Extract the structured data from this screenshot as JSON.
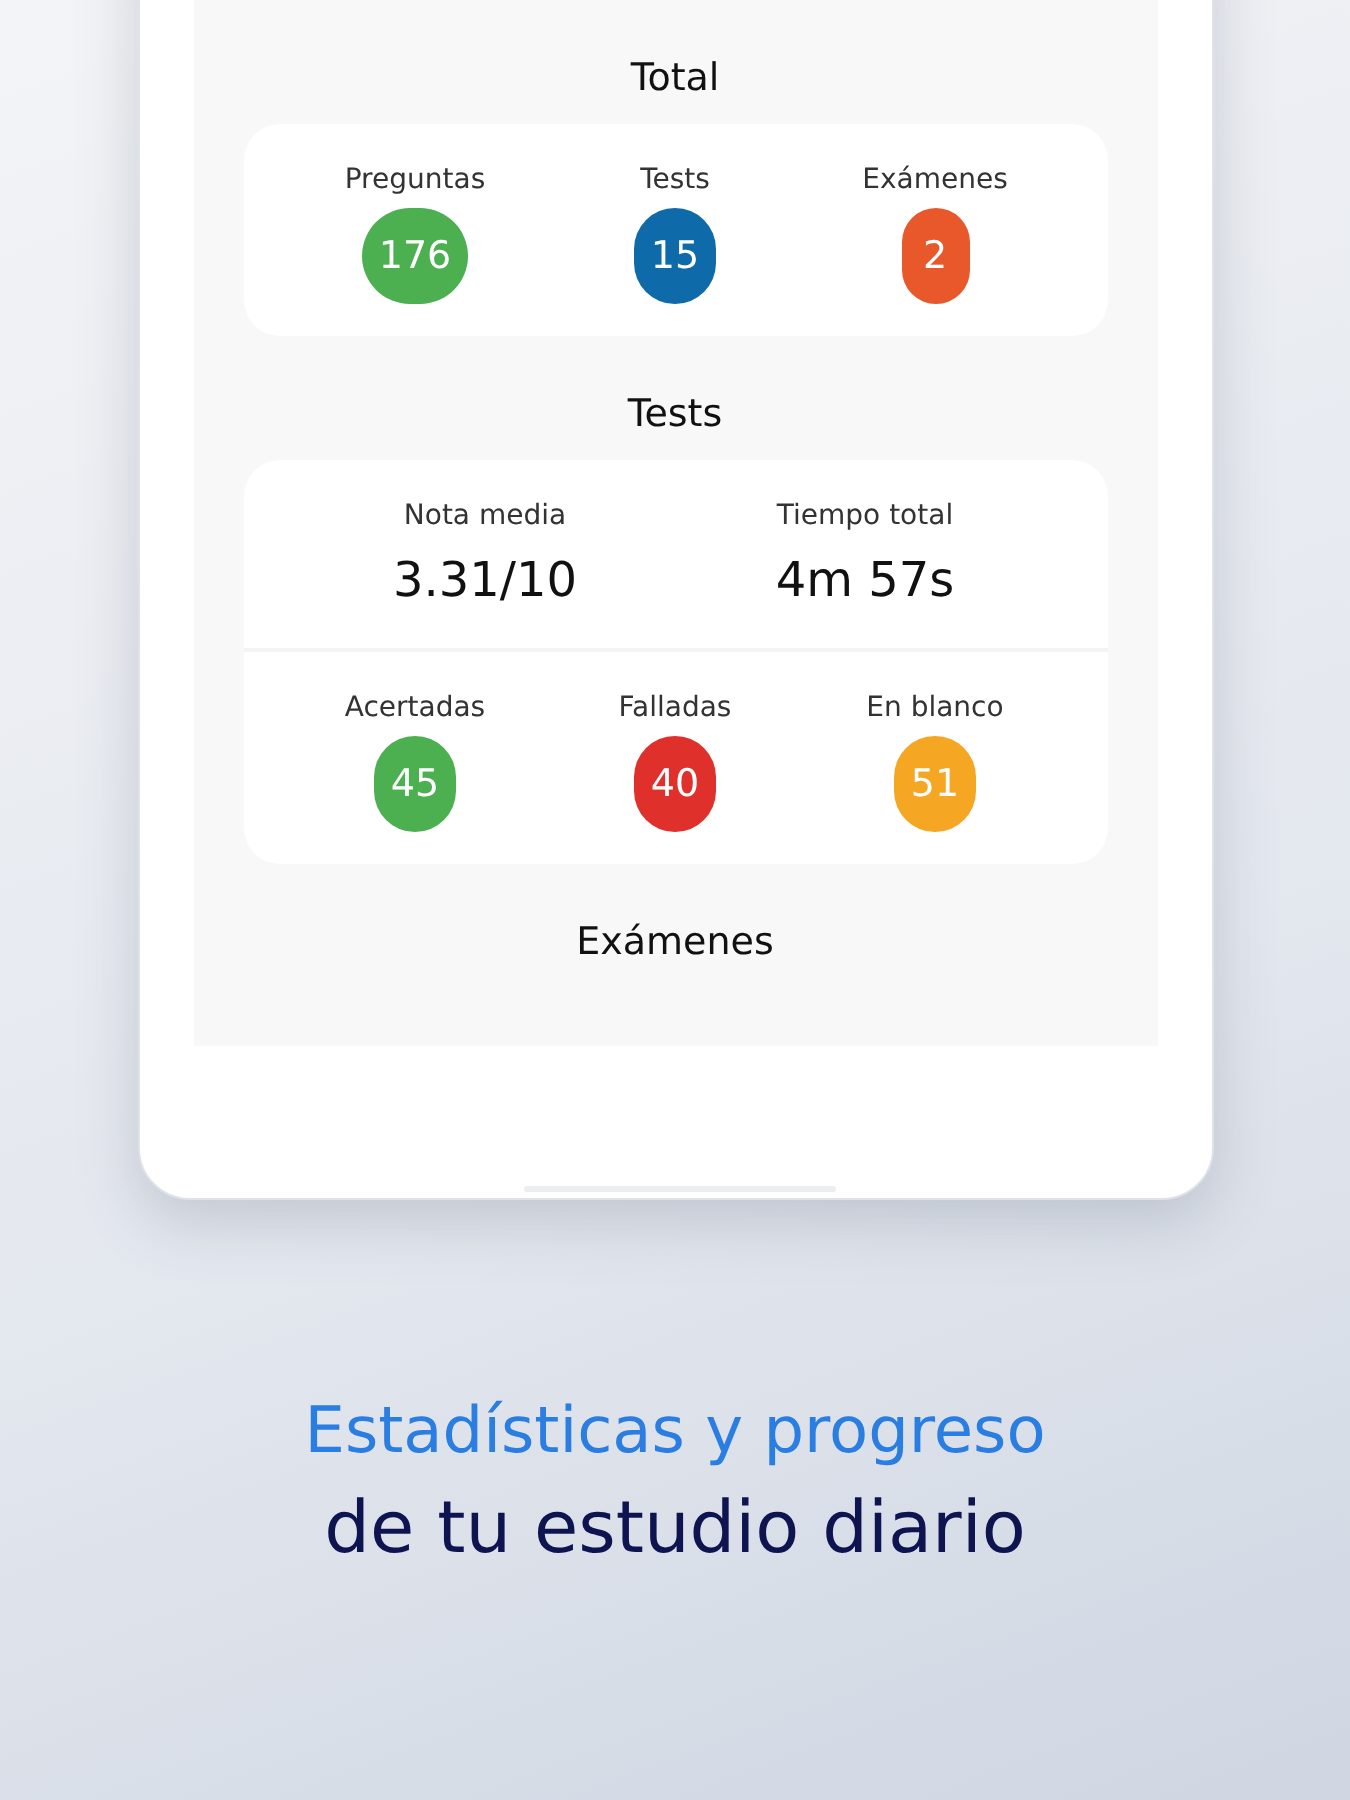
{
  "sections": [
    {
      "title": "Total",
      "groups": [
        {
          "kind": "counts",
          "items": [
            {
              "label": "Preguntas",
              "value": "176",
              "color": "#4caf50"
            },
            {
              "label": "Tests",
              "value": "15",
              "color": "#0e6aa8"
            },
            {
              "label": "Exámenes",
              "value": "2",
              "color": "#e8582a"
            }
          ]
        }
      ]
    },
    {
      "title": "Tests",
      "groups": [
        {
          "kind": "figures",
          "items": [
            {
              "label": "Nota media",
              "value": "3.31/10"
            },
            {
              "label": "Tiempo total",
              "value": "4m 57s"
            }
          ]
        },
        {
          "kind": "counts",
          "items": [
            {
              "label": "Acertadas",
              "value": "45",
              "color": "#4caf50"
            },
            {
              "label": "Falladas",
              "value": "40",
              "color": "#e0302b"
            },
            {
              "label": "En blanco",
              "value": "51",
              "color": "#f5a623"
            }
          ]
        }
      ]
    },
    {
      "title": "Exámenes"
    }
  ],
  "caption": {
    "line_1": "Estadísticas y progreso",
    "line_2": "de tu estudio diario"
  }
}
